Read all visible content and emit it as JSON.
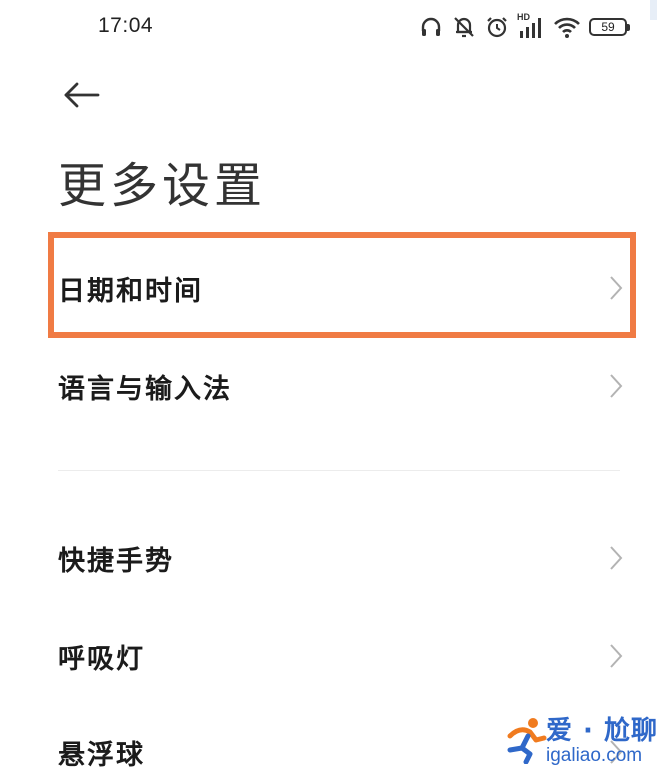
{
  "status_bar": {
    "time": "17:04",
    "hd_label": "HD",
    "battery_level": "59",
    "icons": [
      "headphones-icon",
      "muted-bell-icon",
      "alarm-icon",
      "signal-icon",
      "wifi-icon",
      "battery-icon"
    ]
  },
  "header": {
    "back_icon": "back-arrow-icon",
    "title": "更多设置"
  },
  "settings": {
    "items": [
      {
        "label": "日期和时间",
        "highlighted": true
      },
      {
        "label": "语言与输入法"
      },
      {
        "label": "快捷手势"
      },
      {
        "label": "呼吸灯"
      },
      {
        "label": "悬浮球"
      }
    ]
  },
  "colors": {
    "highlight_border": "#f07b44",
    "watermark_blue": "#2f68c9",
    "watermark_orange": "#f07b1f"
  },
  "watermark": {
    "title": "爱 · 尬聊",
    "url": "igaliao.com"
  }
}
